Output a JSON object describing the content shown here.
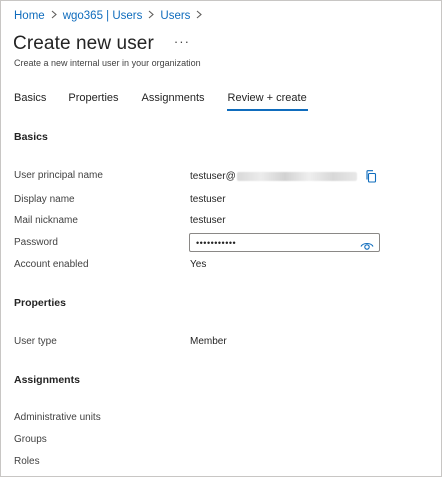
{
  "breadcrumb": {
    "items": [
      "Home",
      "wgo365 | Users",
      "Users"
    ]
  },
  "header": {
    "title": "Create new user",
    "more": "···",
    "subtitle": "Create a new internal user in your organization"
  },
  "tabs": [
    {
      "label": "Basics",
      "active": false
    },
    {
      "label": "Properties",
      "active": false
    },
    {
      "label": "Assignments",
      "active": false
    },
    {
      "label": "Review + create",
      "active": true
    }
  ],
  "basics": {
    "heading": "Basics",
    "upn_label": "User principal name",
    "upn_value": "testuser@",
    "display_name_label": "Display name",
    "display_name_value": "testuser",
    "mail_nickname_label": "Mail nickname",
    "mail_nickname_value": "testuser",
    "password_label": "Password",
    "password_value": "•••••••••••",
    "account_enabled_label": "Account enabled",
    "account_enabled_value": "Yes"
  },
  "properties": {
    "heading": "Properties",
    "user_type_label": "User type",
    "user_type_value": "Member"
  },
  "assignments": {
    "heading": "Assignments",
    "admin_units_label": "Administrative units",
    "groups_label": "Groups",
    "roles_label": "Roles"
  },
  "icons": {
    "copy": "copy-icon",
    "eye": "eye-icon",
    "chevron": "chevron-right-icon"
  },
  "colors": {
    "accent": "#0f6cbd",
    "text": "#242424"
  }
}
